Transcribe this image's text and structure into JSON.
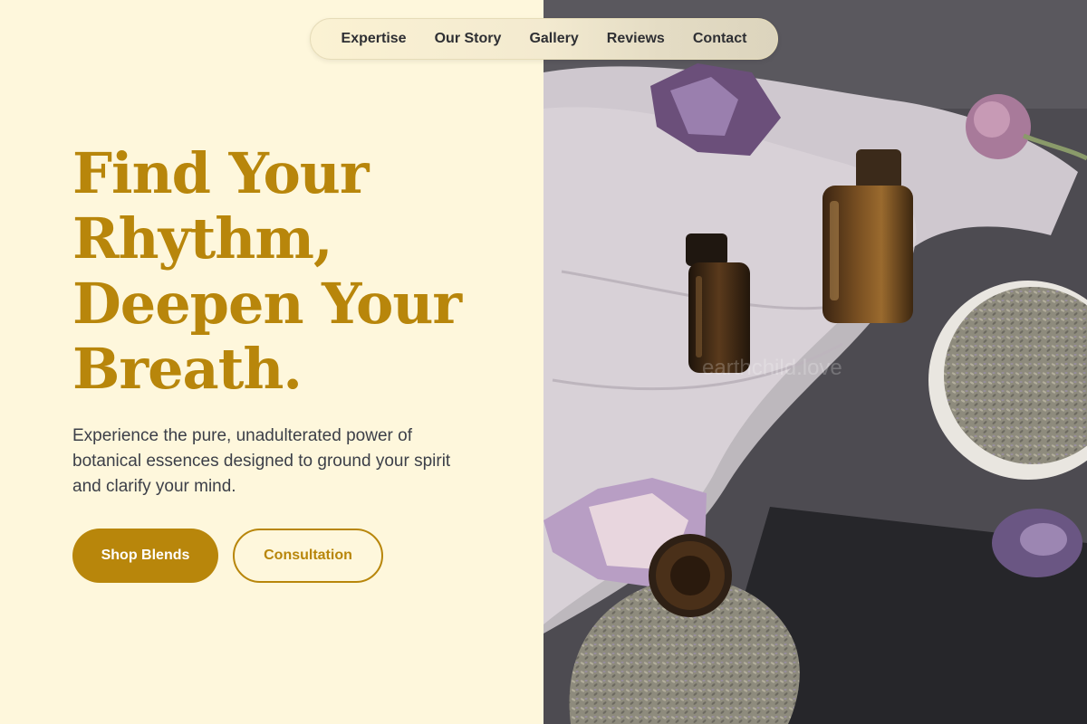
{
  "nav": {
    "items": [
      {
        "label": "Expertise"
      },
      {
        "label": "Our Story"
      },
      {
        "label": "Gallery"
      },
      {
        "label": "Reviews"
      },
      {
        "label": "Contact"
      }
    ]
  },
  "hero": {
    "title_lines": [
      "Find Your",
      "Rhythm,",
      "Deepen Your",
      "Breath."
    ],
    "subtitle": "Experience the pure, unadulterated power of botanical essences designed to ground your spirit and clarify your mind.",
    "primary_button": "Shop Blends",
    "secondary_button": "Consultation"
  },
  "photo": {
    "watermark": "earthchild.love"
  },
  "colors": {
    "accent": "#b8860b",
    "background": "#fef7dc",
    "text": "#3c3f48"
  }
}
